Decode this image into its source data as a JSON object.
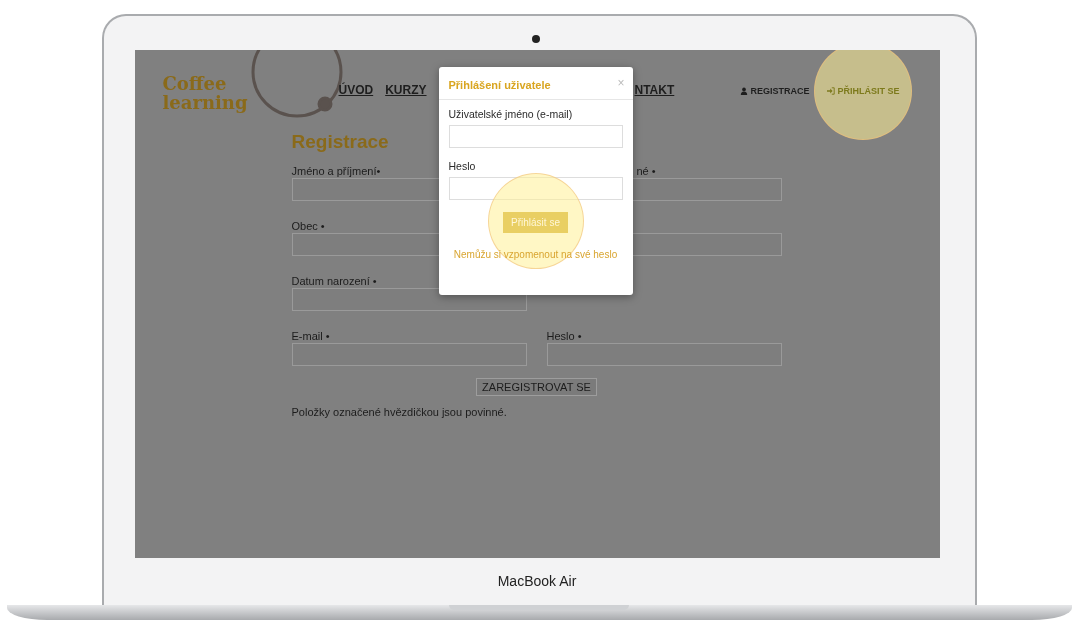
{
  "laptop": {
    "label": "MacBook Air"
  },
  "header": {
    "logo": [
      "Coffee",
      "learning"
    ],
    "nav": [
      {
        "label": "ÚVOD"
      },
      {
        "label": "KURZY"
      },
      {
        "label": "NTAKT"
      }
    ],
    "account_links": [
      {
        "kind": "register",
        "label": "REGISTRACE",
        "highlighted": false
      },
      {
        "kind": "login",
        "label": "PŘIHLÁSIT SE",
        "highlighted": true
      }
    ]
  },
  "registration": {
    "title": "Registrace",
    "rows": [
      {
        "cells": [
          {
            "label": "Jméno a příjmení•"
          },
          {
            "label": "né •"
          }
        ]
      },
      {
        "cells": [
          {
            "label": "Obec •"
          },
          {}
        ]
      },
      {
        "cells": [
          {
            "label": "Datum narození •"
          }
        ]
      },
      {
        "cells": [
          {
            "label": "E-mail •"
          },
          {
            "label": "Heslo •"
          }
        ]
      }
    ],
    "submit": "ZAREGISTROVAT SE",
    "note": "Položky označené hvězdičkou jsou povinné."
  },
  "login_dialog": {
    "title": "Přihlášení uživatele",
    "close": "×",
    "fields": [
      {
        "label": "Uživatelské jméno (e-mail)"
      },
      {
        "label": "Heslo"
      }
    ],
    "button": {
      "label": "Přihlásit se",
      "highlighted": true
    },
    "forgot_link": "Nemůžu si vzpomenout na své heslo"
  }
}
